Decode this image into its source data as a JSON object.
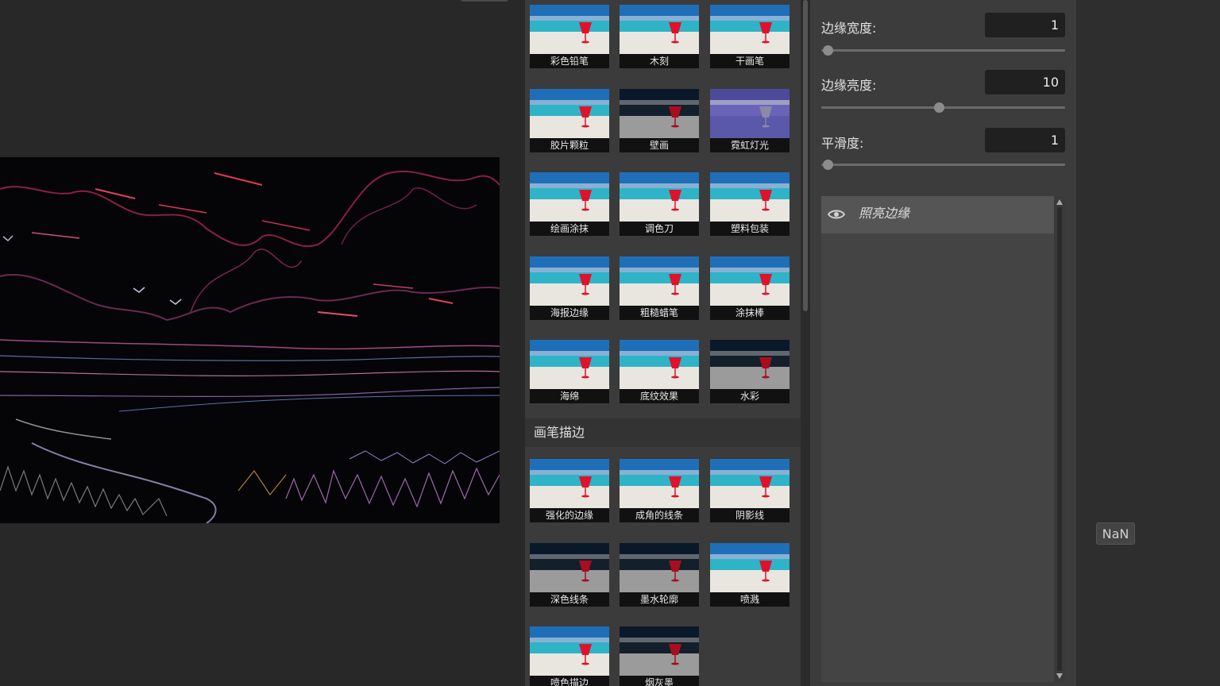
{
  "filters": {
    "group1": [
      {
        "label": "彩色铅笔",
        "icon": "beach-thumbnail"
      },
      {
        "label": "木刻",
        "icon": "beach-thumbnail"
      },
      {
        "label": "干画笔",
        "icon": "beach-thumbnail"
      },
      {
        "label": "胶片颗粒",
        "icon": "beach-thumbnail"
      },
      {
        "label": "壁画",
        "icon": "beach-thumbnail"
      },
      {
        "label": "霓虹灯光",
        "icon": "beach-thumbnail"
      },
      {
        "label": "绘画涂抹",
        "icon": "beach-thumbnail"
      },
      {
        "label": "调色刀",
        "icon": "beach-thumbnail"
      },
      {
        "label": "塑料包装",
        "icon": "beach-thumbnail"
      },
      {
        "label": "海报边缘",
        "icon": "beach-thumbnail"
      },
      {
        "label": "粗糙蜡笔",
        "icon": "beach-thumbnail"
      },
      {
        "label": "涂抹棒",
        "icon": "beach-thumbnail"
      },
      {
        "label": "海绵",
        "icon": "beach-thumbnail"
      },
      {
        "label": "底纹效果",
        "icon": "beach-thumbnail"
      },
      {
        "label": "水彩",
        "icon": "beach-thumbnail"
      }
    ],
    "group2_title": "画笔描边",
    "group2": [
      {
        "label": "强化的边缘",
        "icon": "beach-thumbnail"
      },
      {
        "label": "成角的线条",
        "icon": "beach-thumbnail"
      },
      {
        "label": "阴影线",
        "icon": "beach-thumbnail"
      },
      {
        "label": "深色线条",
        "icon": "beach-thumbnail"
      },
      {
        "label": "墨水轮廓",
        "icon": "beach-thumbnail"
      },
      {
        "label": "喷溅",
        "icon": "beach-thumbnail"
      },
      {
        "label": "喷色描边",
        "icon": "beach-thumbnail"
      },
      {
        "label": "烟灰墨",
        "icon": "beach-thumbnail"
      }
    ]
  },
  "params": [
    {
      "label": "边缘宽度:",
      "value": "1",
      "level": 0.0
    },
    {
      "label": "边缘亮度:",
      "value": "10",
      "level": 0.48
    },
    {
      "label": "平滑度:",
      "value": "1",
      "level": 0.0
    }
  ],
  "layers": [
    {
      "name": "照亮边缘",
      "icon": "eye-icon"
    }
  ],
  "badge": {
    "text": "NaN"
  },
  "colors": {
    "sky": "#1f6fb8",
    "sea": "#2fb3c7",
    "sand": "#e9e6df",
    "glass": "#e0122b",
    "panel": "#3c3c3c",
    "canvas": "#282828"
  }
}
